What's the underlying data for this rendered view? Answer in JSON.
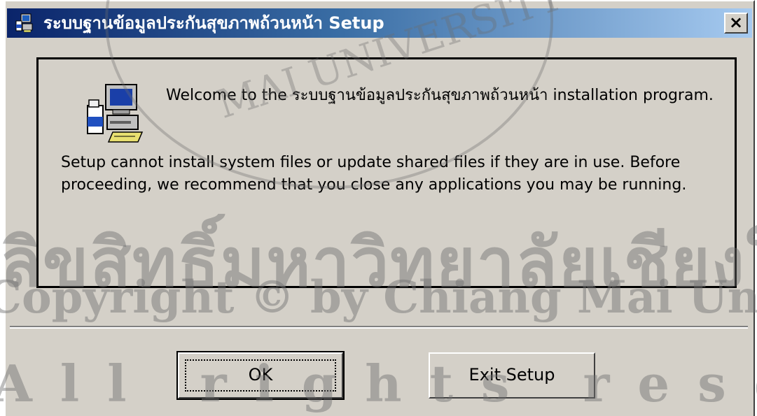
{
  "window": {
    "title": "ระบบฐานข้อมูลประกันสุขภาพถ้วนหน้า Setup",
    "close_label": "×"
  },
  "content": {
    "welcome": "Welcome to the ระบบฐานข้อมูลประกันสุขภาพถ้วนหน้า installation program.",
    "notice": "Setup cannot install system files or update shared files if they are in use. Before proceeding, we recommend that you close any applications you may be running."
  },
  "buttons": {
    "ok": "OK",
    "exit": "Exit Setup"
  },
  "watermark": {
    "line1": "ลิขสิทธิ์มหาวิทยาลัยเชียงใหม่",
    "line2": "Copyright © by Chiang Mai University",
    "line3": "All rights reserved",
    "seal": "MAI UNIVERSITY"
  },
  "colors": {
    "dialog_bg": "#d4d0c8",
    "title_start": "#0a246a",
    "title_end": "#a6caf0"
  }
}
